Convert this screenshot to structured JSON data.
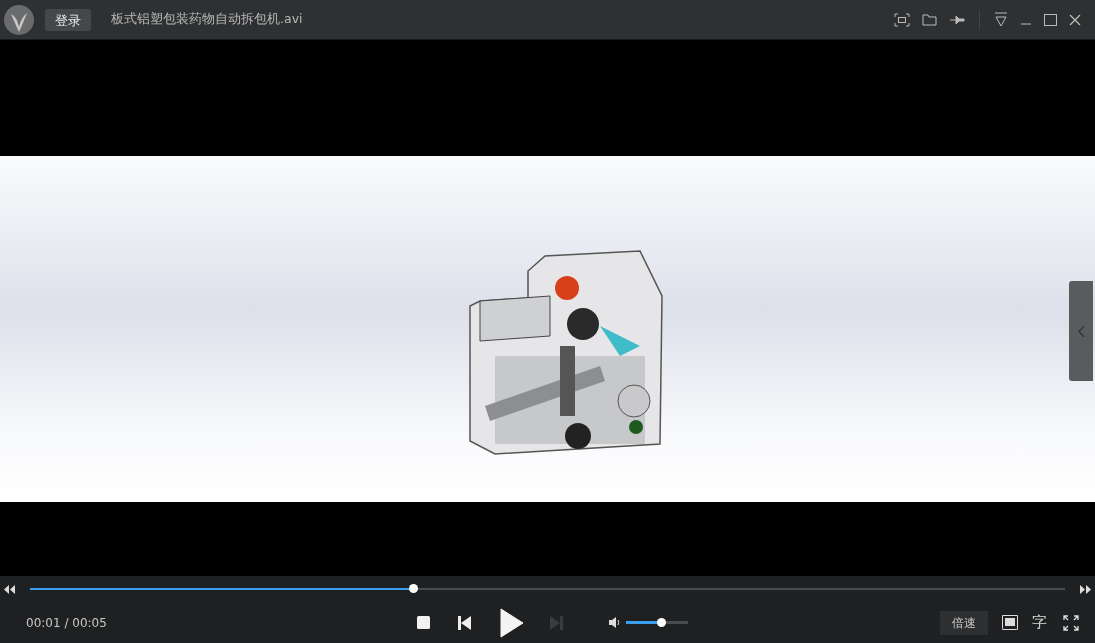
{
  "title_bar": {
    "login_button": "登录",
    "file_name": "板式铝塑包装药物自动拆包机.avi"
  },
  "progress": {
    "level": 0.37
  },
  "controls": {
    "time": "00:01 / 00:05",
    "next_disabled": true,
    "volume": {
      "level": 0.56
    },
    "speed_button": "倍速",
    "subtitle_button": "字"
  }
}
